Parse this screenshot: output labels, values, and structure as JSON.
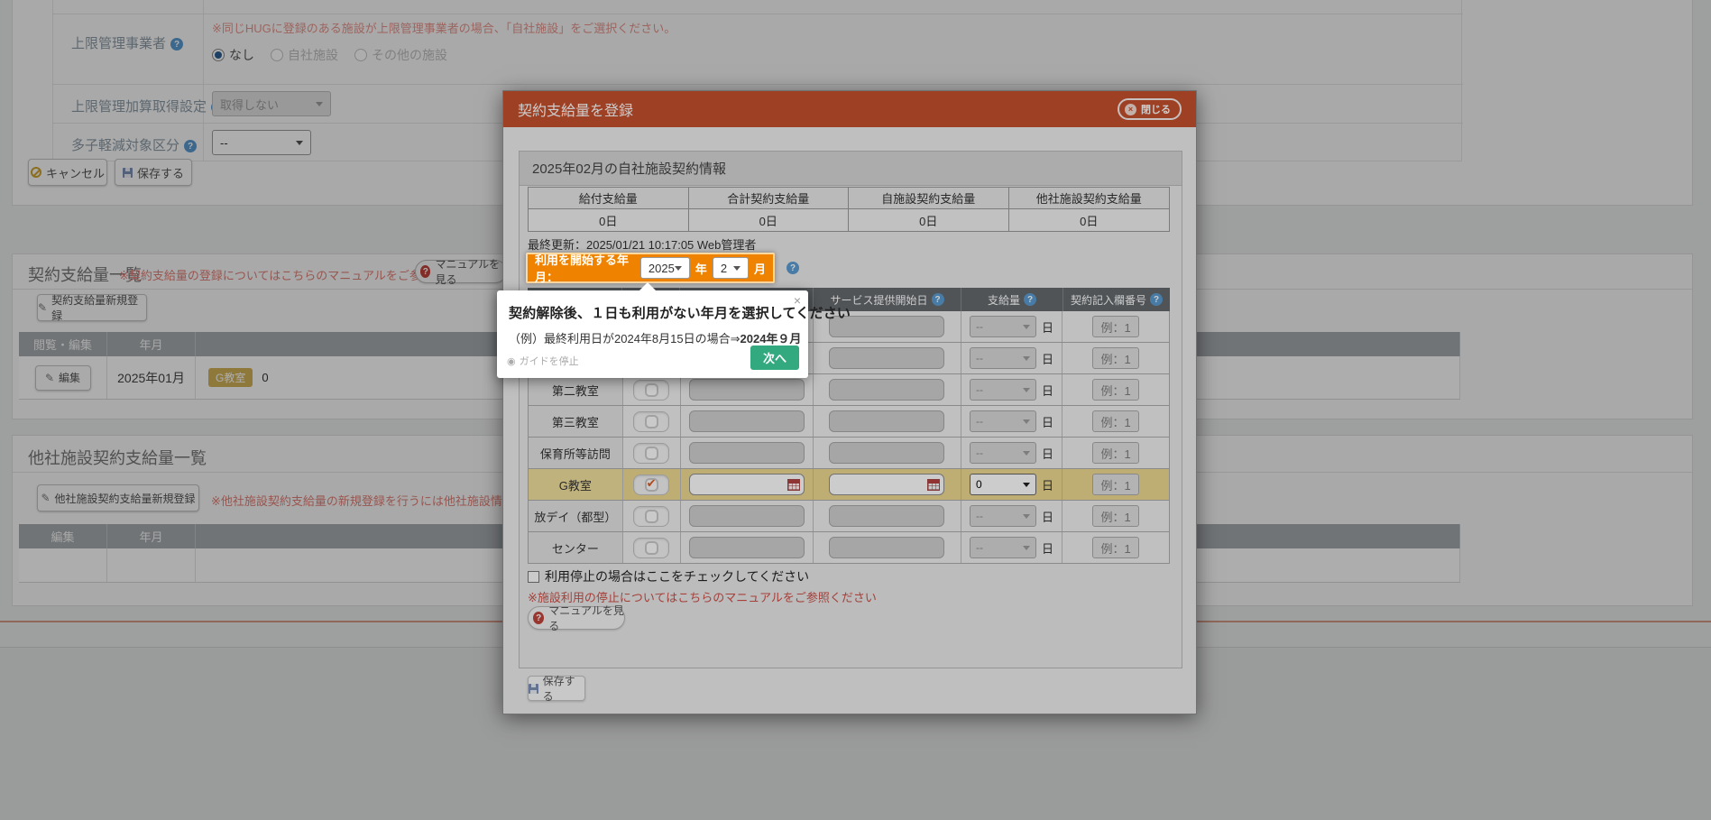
{
  "icons": {
    "help": "?",
    "close": "×",
    "check": "✔",
    "edit": "✎",
    "guide_dot": "◉"
  },
  "page": {
    "form": {
      "row_limit_manager": {
        "label": "上限管理事業者",
        "note": "※同じHUGに登録のある施設が上限管理事業者の場合、「自社施設」をご選択ください。",
        "radio_none": "なし",
        "radio_own": "自社施設",
        "radio_other": "その他の施設"
      },
      "row_addition": {
        "label": "上限管理加算取得設定",
        "value": "取得しない"
      },
      "row_tashi": {
        "label": "多子軽減対象区分",
        "value": "--"
      },
      "cancel_label": "キャンセル",
      "save_label": "保存する"
    },
    "contract_list": {
      "title": "契約支給量一覧",
      "note": "※契約支給量の登録についてはこちらのマニュアルをご参照ください",
      "manual_btn": "マニュアルを見る",
      "new_btn": "契約支給量新規登録",
      "col_view_edit": "閲覧・編集",
      "col_month": "年月",
      "row": {
        "edit_btn": "編集",
        "month": "2025年01月",
        "badge": "G教室",
        "count": "0"
      }
    },
    "other_list": {
      "title": "他社施設契約支給量一覧",
      "new_btn": "他社施設契約支給量新規登録",
      "note": "※他社施設契約支給量の新規登録を行うには他社施設情報の登録が必要で",
      "col_edit": "編集",
      "col_month": "年月"
    }
  },
  "modal": {
    "title": "契約支給量を登録",
    "close_label": "閉じる",
    "section_title": "2025年02月の自社施設契約情報",
    "summary": {
      "headers": [
        "給付支給量",
        "合計契約支給量",
        "自施設契約支給量",
        "他社施設契約支給量"
      ],
      "values": [
        "0日",
        "0日",
        "0日",
        "0日"
      ]
    },
    "last_update": "最終更新：2025/01/21 10:17:05  Web管理者",
    "start_month": {
      "label": "利用を開始する年月：",
      "year": "2025",
      "year_suffix": "年",
      "month": "2",
      "month_suffix": "月"
    },
    "table": {
      "headers": [
        "",
        "",
        "",
        "サービス提供開始日",
        "支給量",
        "契約記入欄番号"
      ],
      "unit": "日",
      "rows": [
        {
          "name": "",
          "checked": false,
          "enabled": false,
          "qty": "--",
          "example": "例：1",
          "highlight": false
        },
        {
          "name": "",
          "checked": false,
          "enabled": false,
          "qty": "--",
          "example": "例：1",
          "highlight": false
        },
        {
          "name": "第二教室",
          "checked": false,
          "enabled": false,
          "qty": "--",
          "example": "例：1",
          "highlight": false
        },
        {
          "name": "第三教室",
          "checked": false,
          "enabled": false,
          "qty": "--",
          "example": "例：1",
          "highlight": false
        },
        {
          "name": "保育所等訪問",
          "checked": false,
          "enabled": false,
          "qty": "--",
          "example": "例：1",
          "highlight": false
        },
        {
          "name": "G教室",
          "checked": true,
          "enabled": true,
          "qty": "0",
          "example": "例：1",
          "highlight": true
        },
        {
          "name": "放デイ（都型）",
          "checked": false,
          "enabled": false,
          "qty": "--",
          "example": "例：1",
          "highlight": false
        },
        {
          "name": "センター",
          "checked": false,
          "enabled": false,
          "qty": "--",
          "example": "例：1",
          "highlight": false
        }
      ]
    },
    "stop_checkbox_label": "利用停止の場合はここをチェックしてください",
    "stop_note": "※施設利用の停止についてはこちらのマニュアルをご参照ください",
    "manual_btn": "マニュアルを見る",
    "save_label": "保存する"
  },
  "tooltip": {
    "title": "契約解除後、１日も利用がない年月を選択してください",
    "example_prefix": "（例）最終利用日が2024年8月15日の場合⇒",
    "example_bold": "2024年９月",
    "stop_guide": "ガイドを停止",
    "next_btn": "次へ"
  }
}
